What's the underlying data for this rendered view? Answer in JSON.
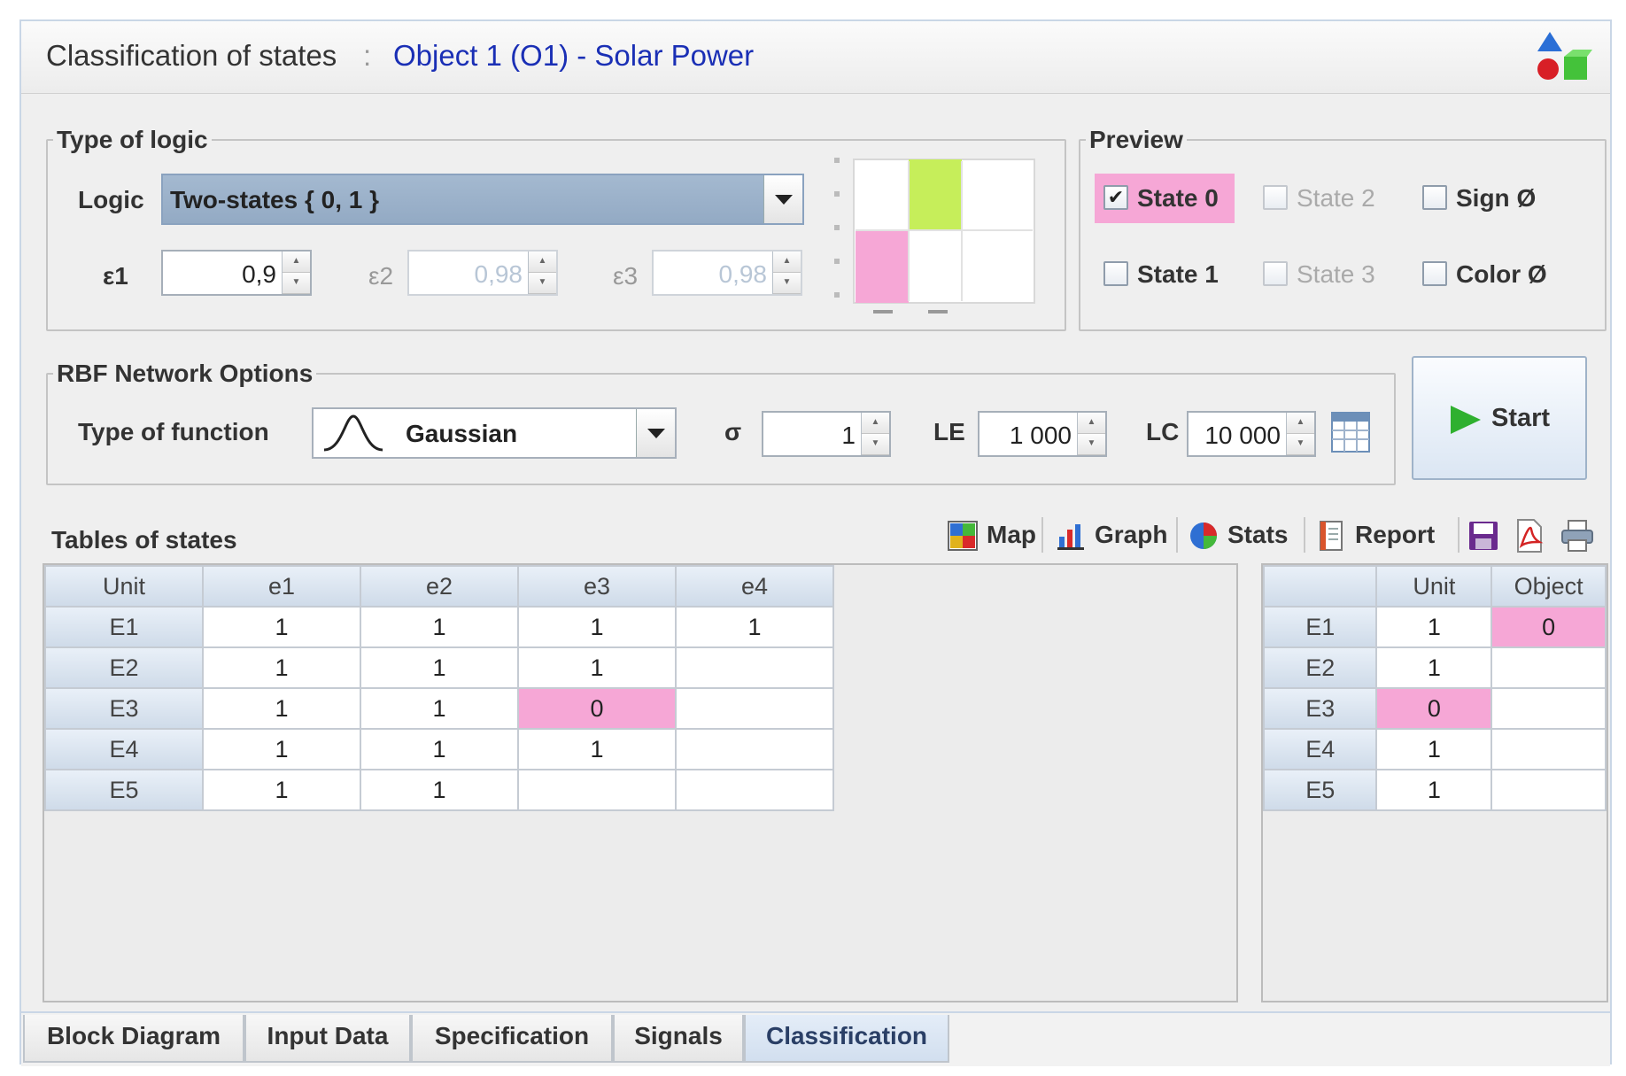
{
  "header": {
    "title": "Classification of states",
    "separator": ":",
    "object": "Object 1 (O1) - Solar Power"
  },
  "logic_group": {
    "legend": "Type of logic",
    "logic_label": "Logic",
    "logic_value": "Two-states { 0, 1 }",
    "e1_label": "ε1",
    "e1_value": "0,9",
    "e2_label": "ε2",
    "e2_value": "0,98",
    "e3_label": "ε3",
    "e3_value": "0,98"
  },
  "preview": {
    "legend": "Preview",
    "state0": "State 0",
    "state1": "State 1",
    "state2": "State 2",
    "state3": "State 3",
    "sign": "Sign Ø",
    "color": "Color Ø",
    "state0_checked": true
  },
  "rbf": {
    "legend": "RBF Network Options",
    "function_label": "Type of function",
    "function_value": "Gaussian",
    "sigma_label": "σ",
    "sigma_value": "1",
    "le_label": "LE",
    "le_value": "1 000",
    "lc_label": "LC",
    "lc_value": "10 000"
  },
  "start_label": "Start",
  "tables": {
    "title": "Tables of states",
    "toolbar": {
      "map": "Map",
      "graph": "Graph",
      "stats": "Stats",
      "report": "Report"
    },
    "main_headers": [
      "Unit",
      "e1",
      "e2",
      "e3",
      "e4"
    ],
    "main_rows": [
      [
        "E1",
        "1",
        "1",
        "1",
        "1"
      ],
      [
        "E2",
        "1",
        "1",
        "1",
        ""
      ],
      [
        "E3",
        "1",
        "1",
        "0",
        ""
      ],
      [
        "E4",
        "1",
        "1",
        "1",
        ""
      ],
      [
        "E5",
        "1",
        "1",
        "",
        ""
      ]
    ],
    "side_headers": [
      "",
      "Unit",
      "Object"
    ],
    "side_rows": [
      [
        "E1",
        "1",
        "0"
      ],
      [
        "E2",
        "1",
        ""
      ],
      [
        "E3",
        "0",
        ""
      ],
      [
        "E4",
        "1",
        ""
      ],
      [
        "E5",
        "1",
        ""
      ]
    ]
  },
  "tabs": [
    "Block Diagram",
    "Input Data",
    "Specification",
    "Signals",
    "Classification"
  ],
  "colors": {
    "highlight": "#f6a7d6",
    "preview_green": "#c6ee5a",
    "title_blue": "#1a2fb5"
  }
}
